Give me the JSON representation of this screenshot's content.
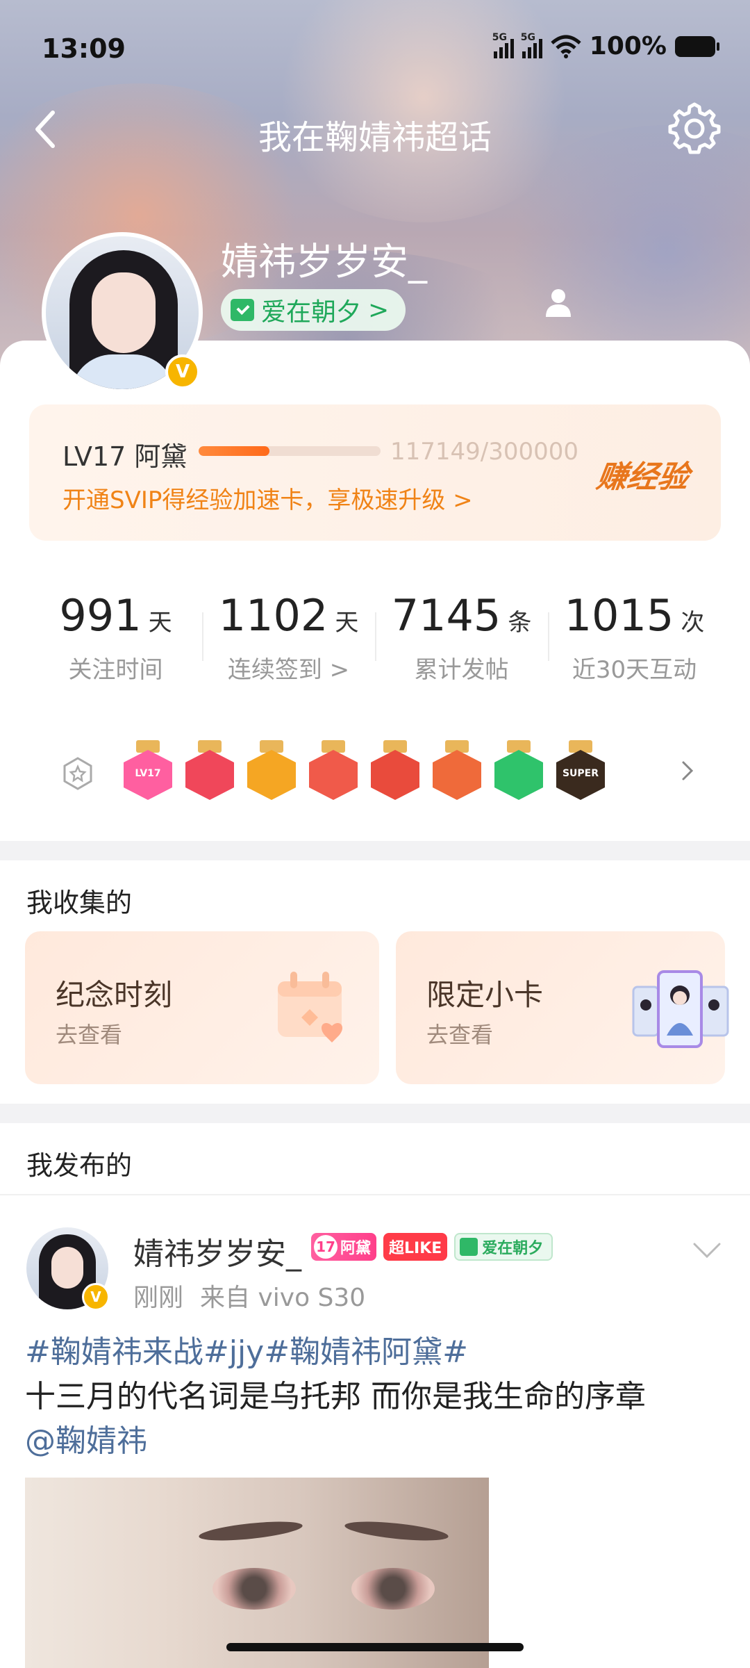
{
  "status": {
    "time": "13:09",
    "net1": "5G",
    "net2": "5G",
    "battery": "100%"
  },
  "nav": {
    "title": "我在鞠婧祎超话"
  },
  "profile": {
    "username": "婧祎岁岁安_",
    "fan_tag": "爱在朝夕",
    "fan_tag_arrow": ">",
    "verified": "V"
  },
  "level": {
    "name": "LV17 阿黛",
    "exp": "117149/300000",
    "progress": 0.39,
    "promo": "开通SVIP得经验加速卡，享极速升级 >",
    "earn": "赚经验"
  },
  "stats": [
    {
      "num": "991",
      "unit": "天",
      "label": "关注时间"
    },
    {
      "num": "1102",
      "unit": "天",
      "label": "连续签到 >"
    },
    {
      "num": "7145",
      "unit": "条",
      "label": "累计发帖"
    },
    {
      "num": "1015",
      "unit": "次",
      "label": "近30天互动"
    }
  ],
  "badges": [
    {
      "name": "lv17-badge",
      "label": "LV17",
      "color": "#ff5fa0"
    },
    {
      "name": "trophy-badge",
      "label": "",
      "color": "#f0475a"
    },
    {
      "name": "crown-badge",
      "label": "",
      "color": "#f5a623"
    },
    {
      "name": "cat-badge-1",
      "label": "",
      "color": "#f05a4a"
    },
    {
      "name": "cat-badge-2",
      "label": "",
      "color": "#e94b3c"
    },
    {
      "name": "cat-badge-3",
      "label": "",
      "color": "#ef6a3a"
    },
    {
      "name": "hand-badge",
      "label": "",
      "color": "#2fc36b"
    },
    {
      "name": "super-badge",
      "label": "SUPER",
      "color": "#3a2a1e"
    }
  ],
  "collect": {
    "title": "我收集的",
    "cards": [
      {
        "title": "纪念时刻",
        "sub": "去查看"
      },
      {
        "title": "限定小卡",
        "sub": "去查看"
      }
    ]
  },
  "posted": {
    "title": "我发布的",
    "post": {
      "author": "婧祎岁岁安_",
      "lv_num": "17",
      "lv_name": "阿黛",
      "like_tag": "超LIKE",
      "fan_tag": "爱在朝夕",
      "time": "刚刚",
      "source": "来自 vivo S30",
      "hashtags": "#鞠婧祎来战#jjy#鞠婧祎阿黛#",
      "body": "十三月的代名词是乌托邦  而你是我生命的序章",
      "mention": "@鞠婧祎"
    }
  },
  "colors": {
    "accent": "#f08316",
    "green": "#2fb867",
    "link": "#4e6e9a"
  }
}
